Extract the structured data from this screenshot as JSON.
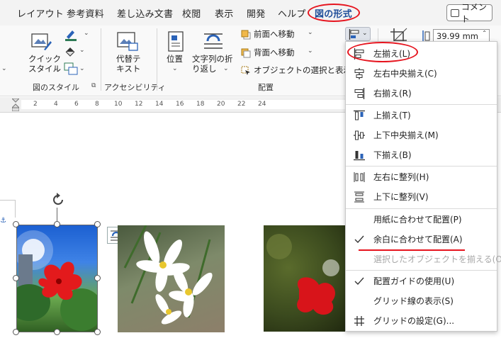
{
  "tabs": [
    {
      "label": "レイアウト"
    },
    {
      "label": "参考資料"
    },
    {
      "label": "差し込み文書"
    },
    {
      "label": "校閲"
    },
    {
      "label": "表示"
    },
    {
      "label": "開発"
    },
    {
      "label": "ヘルプ"
    },
    {
      "label": "図の形式"
    }
  ],
  "comment_button": {
    "label": "コメント"
  },
  "ribbon": {
    "quick_style": "クイック\nスタイル",
    "alt_text": "代替テ\nキスト",
    "position": "位置",
    "wrap_text": "文字列の折\nり返し",
    "bring_forward": "前面へ移動",
    "send_backward": "背面へ移動",
    "selection_pane": "オブジェクトの選択と表示",
    "groups": {
      "picture_styles": "図のスタイル",
      "accessibility": "アクセシビリティ",
      "arrange": "配置"
    },
    "width_value": "39.99 mm"
  },
  "ruler": {
    "ticks": [
      "2",
      "4",
      "6",
      "8",
      "10",
      "12",
      "14",
      "16",
      "18",
      "20",
      "22",
      "24"
    ]
  },
  "align_menu": {
    "items": [
      {
        "label": "左揃え(L)",
        "icon": "align-left-icon",
        "checked": false,
        "disabled": false
      },
      {
        "label": "左右中央揃え(C)",
        "icon": "align-center-icon",
        "checked": false,
        "disabled": false
      },
      {
        "label": "右揃え(R)",
        "icon": "align-right-icon",
        "checked": false,
        "disabled": false
      },
      {
        "label": "上揃え(T)",
        "icon": "align-top-icon",
        "checked": false,
        "disabled": false
      },
      {
        "label": "上下中央揃え(M)",
        "icon": "align-middle-icon",
        "checked": false,
        "disabled": false
      },
      {
        "label": "下揃え(B)",
        "icon": "align-bottom-icon",
        "checked": false,
        "disabled": false
      },
      {
        "label": "左右に整列(H)",
        "icon": "distribute-horizontal-icon",
        "checked": false,
        "disabled": false
      },
      {
        "label": "上下に整列(V)",
        "icon": "distribute-vertical-icon",
        "checked": false,
        "disabled": false
      },
      {
        "label": "用紙に合わせて配置(P)",
        "icon": "",
        "checked": false,
        "disabled": false
      },
      {
        "label": "余白に合わせて配置(A)",
        "icon": "check-icon",
        "checked": true,
        "disabled": false
      },
      {
        "label": "選択したオブジェクトを揃える(O)",
        "icon": "",
        "checked": false,
        "disabled": true
      },
      {
        "label": "配置ガイドの使用(U)",
        "icon": "check-icon",
        "checked": true,
        "disabled": false
      },
      {
        "label": "グリッド線の表示(S)",
        "icon": "",
        "checked": false,
        "disabled": false
      },
      {
        "label": "グリッドの設定(G)...",
        "icon": "grid-icon",
        "checked": false,
        "disabled": false
      }
    ]
  },
  "colors": {
    "accent": "#1f4e9a",
    "annotation_red": "#e6141e",
    "icon_blue": "#2b63b8"
  }
}
